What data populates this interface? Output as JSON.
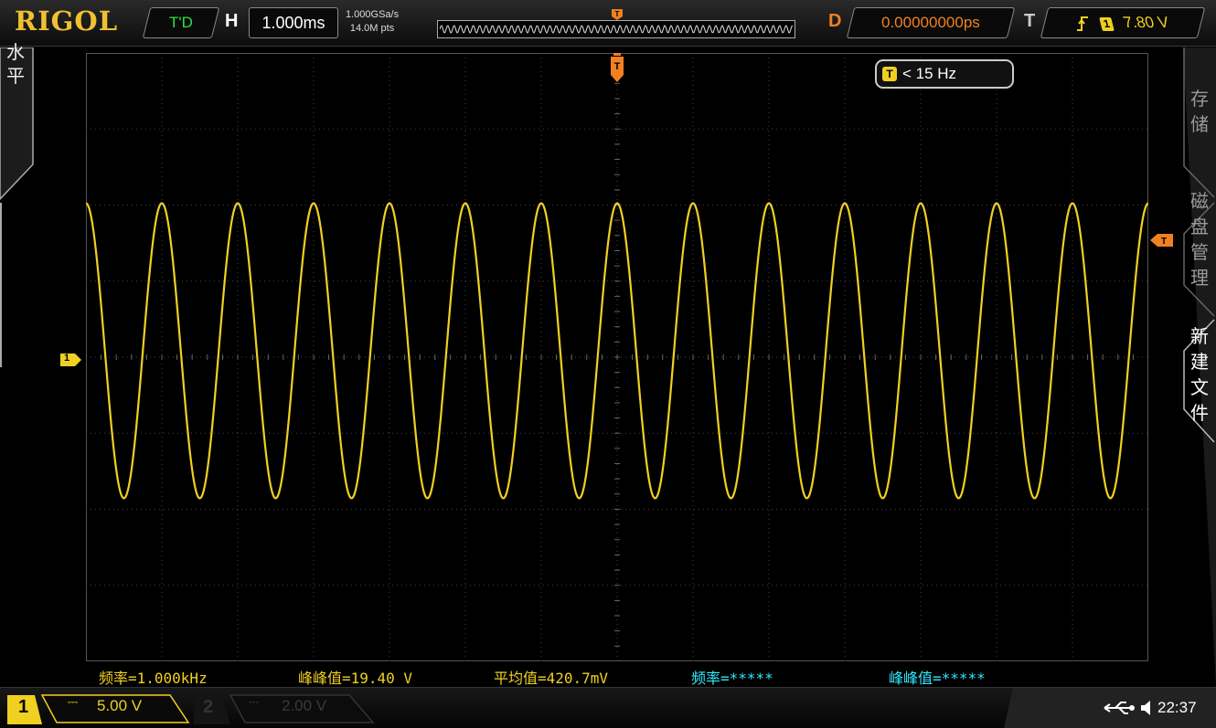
{
  "brand": "RIGOL",
  "top": {
    "status": "T'D",
    "horizontal_label": "H",
    "timebase": "1.000ms",
    "sample_rate": "1.000GSa/s",
    "memory_depth": "14.0M pts",
    "delay_label": "D",
    "delay_value": "0.00000000ps",
    "trigger_label": "T",
    "trigger_source": "1",
    "trigger_level": "7.80 V"
  },
  "left_tab": {
    "label": "水平"
  },
  "right_panel": {
    "store": "存储",
    "disk_manage": "磁盘管理",
    "new_file": "新建文件"
  },
  "trigger_freq": {
    "badge": "T",
    "text": "< 15 Hz"
  },
  "channel_marker": "1",
  "measurements": [
    {
      "text": "频率=1.000kHz",
      "color": "yellow"
    },
    {
      "text": "峰峰值=19.40 V",
      "color": "yellow"
    },
    {
      "text": "平均值=420.7mV",
      "color": "yellow"
    },
    {
      "text": "频率=*****",
      "color": "cyan"
    },
    {
      "text": "峰峰值=*****",
      "color": "cyan"
    }
  ],
  "channels": [
    {
      "number": "1",
      "coupling": "⎓",
      "scale": "5.00 V",
      "active": true
    },
    {
      "number": "2",
      "coupling": "⎓",
      "scale": "2.00 V",
      "active": false
    }
  ],
  "clock": "22:37",
  "colors": {
    "ch1": "#f0d020",
    "trigger": "#f08020",
    "cyan": "#30e8ff",
    "status": "#30e040"
  },
  "chart_data": {
    "type": "line",
    "series": [
      {
        "name": "CH1",
        "shape": "sine",
        "frequency_khz": 1.0,
        "peak_to_peak_v": 19.4,
        "mean_mv": 420.7
      }
    ],
    "x_range_ms": [
      -7,
      7
    ],
    "y_range_v": [
      -20,
      20
    ],
    "grid": true
  }
}
